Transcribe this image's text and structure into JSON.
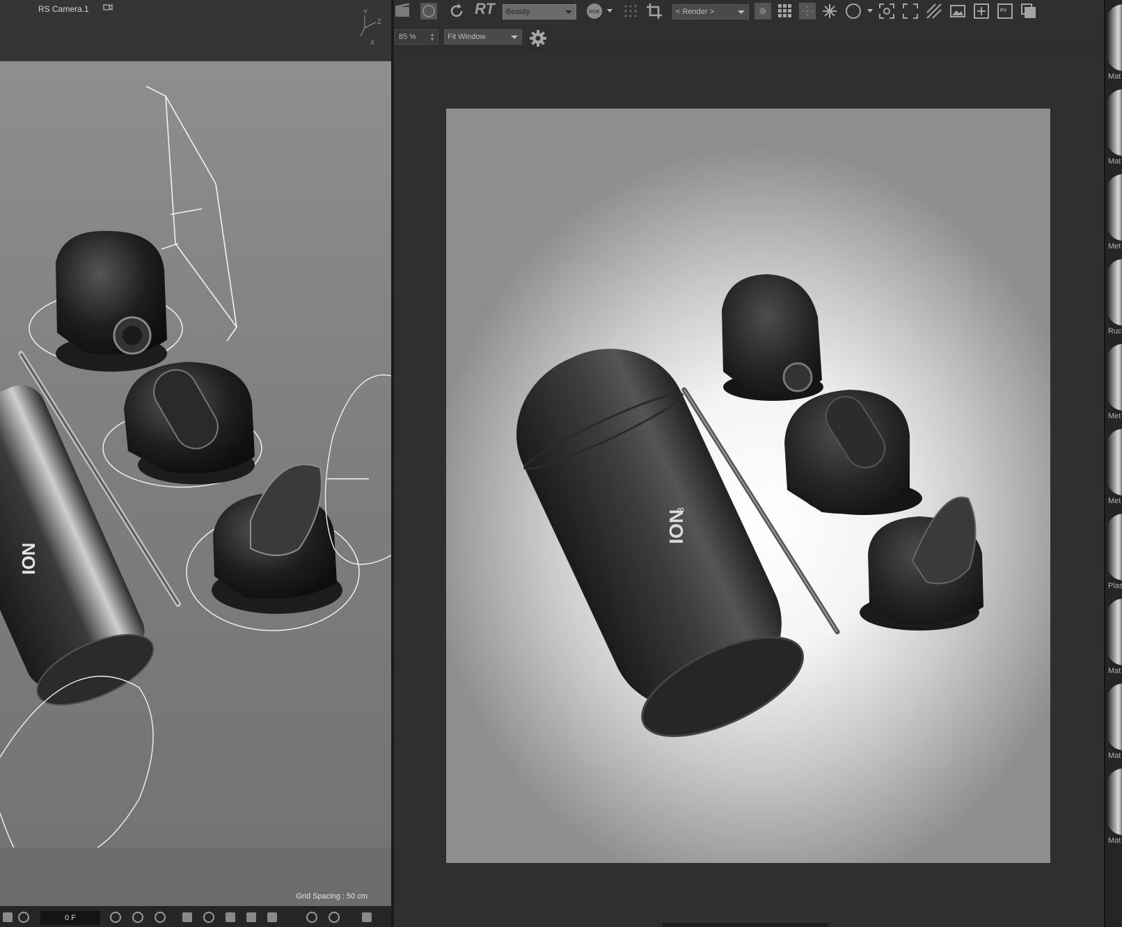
{
  "viewport": {
    "camera_label": "RS Camera.1",
    "axis": {
      "y": "Y",
      "z": "Z",
      "x": "X"
    },
    "grid_spacing": "Grid Spacing : 50 cm",
    "frame_field": "0 F",
    "product_logo": "ION"
  },
  "renderview": {
    "rt_label": "RT",
    "aov_dropdown": "Beauty",
    "channel_button": "RGB",
    "render_dropdown": "< Render >",
    "pv_icon_label": "PV",
    "zoom_value": "85 %",
    "fit_dropdown": "Fit Window",
    "product_logo": "ION",
    "product_logo_super": "8"
  },
  "material_strip": {
    "labels": [
      "Mat",
      "Mat",
      "Met",
      "Ruc",
      "Met",
      "Met",
      "Plas",
      "Mat",
      "Mat",
      "Mat"
    ]
  },
  "colors": {
    "panel_bg": "#2f2f2f",
    "viewport_bg": "#8a8a8a",
    "bottle": "#2a2a2a"
  }
}
